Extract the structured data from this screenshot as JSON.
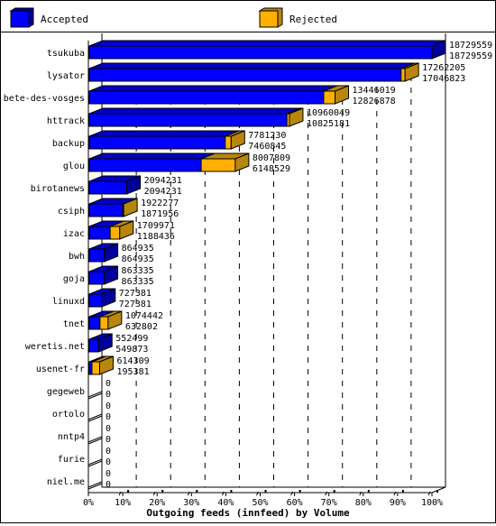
{
  "chart_data": {
    "type": "bar",
    "orientation": "horizontal",
    "stacked": true,
    "style": "3d",
    "title": "",
    "xlabel": "Outgoing feeds (innfeed) by Volume",
    "ylabel": "",
    "xlim": [
      0,
      100
    ],
    "x_unit": "%",
    "x_ticks": [
      "0%",
      "10%",
      "20%",
      "30%",
      "40%",
      "50%",
      "60%",
      "70%",
      "80%",
      "90%",
      "100%"
    ],
    "grid": "vertical dashed",
    "legend": {
      "placement": "top",
      "entries": [
        {
          "name": "Accepted",
          "color": "#0000ff",
          "shade": "#00009c"
        },
        {
          "name": "Rejected",
          "color": "#ffb000",
          "shade": "#b8860b"
        }
      ]
    },
    "scale_max": 18729559,
    "categories": [
      "tsukuba",
      "lysator",
      "bete-des-vosges",
      "httrack",
      "backup",
      "glou",
      "birotanews",
      "csiph",
      "izac",
      "bwh",
      "goja",
      "linuxd",
      "tnet",
      "weretis.net",
      "usenet-fr",
      "gegeweb",
      "ortolo",
      "nntp4",
      "furie",
      "niel.me"
    ],
    "totals": [
      18729559,
      17262205,
      13446019,
      10960049,
      7781230,
      8007809,
      2094231,
      1922277,
      1709971,
      864935,
      863335,
      727381,
      1074442,
      552499,
      614309,
      0,
      0,
      0,
      0,
      0
    ],
    "series": [
      {
        "name": "Accepted",
        "values": [
          18729559,
          17046823,
          12826878,
          10825181,
          7460845,
          6148529,
          2094231,
          1871956,
          1188436,
          864935,
          863335,
          727381,
          632802,
          549873,
          195381,
          0,
          0,
          0,
          0,
          0
        ]
      },
      {
        "name": "Rejected",
        "values": [
          0,
          215382,
          619141,
          134868,
          320385,
          1859280,
          0,
          50321,
          521535,
          0,
          0,
          0,
          441640,
          2626,
          418928,
          0,
          0,
          0,
          0,
          0
        ]
      }
    ],
    "data_labels": {
      "top": [
        18729559,
        17262205,
        13446019,
        10960049,
        7781230,
        8007809,
        2094231,
        1922277,
        1709971,
        864935,
        863335,
        727381,
        1074442,
        552499,
        614309,
        0,
        0,
        0,
        0,
        0
      ],
      "bottom": [
        18729559,
        17046823,
        12826878,
        10825181,
        7460845,
        6148529,
        2094231,
        1871956,
        1188436,
        864935,
        863335,
        727381,
        632802,
        549873,
        195381,
        0,
        0,
        0,
        0,
        0
      ]
    }
  }
}
